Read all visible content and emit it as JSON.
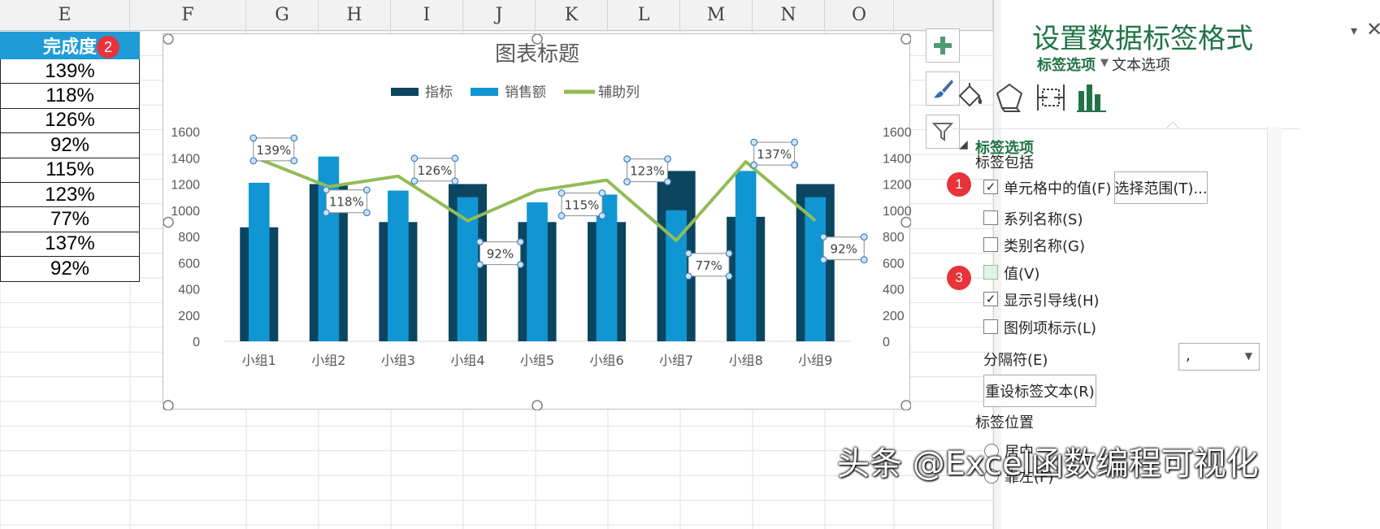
{
  "sheet": {
    "columns": [
      "E",
      "F",
      "G",
      "H",
      "I",
      "J",
      "K",
      "L",
      "M",
      "N",
      "O"
    ],
    "header_cell": "完成度",
    "header_badge": "2",
    "values": [
      "139%",
      "118%",
      "126%",
      "92%",
      "115%",
      "123%",
      "77%",
      "137%",
      "92%"
    ]
  },
  "chart": {
    "side_buttons": {
      "add": "plus-icon",
      "style": "brush-icon",
      "filter": "funnel-icon"
    }
  },
  "chart_data": {
    "type": "bar",
    "title": "图表标题",
    "categories": [
      "小组1",
      "小组2",
      "小组3",
      "小组4",
      "小组5",
      "小组6",
      "小组7",
      "小组8",
      "小组9"
    ],
    "series": [
      {
        "name": "指标",
        "type": "bar",
        "color": "#0b4560",
        "values": [
          870,
          1200,
          910,
          1200,
          910,
          910,
          1300,
          950,
          1200
        ]
      },
      {
        "name": "销售额",
        "type": "bar",
        "color": "#1096d2",
        "values": [
          1210,
          1410,
          1150,
          1100,
          1060,
          1120,
          1000,
          1300,
          1100
        ]
      },
      {
        "name": "辅助列",
        "type": "line",
        "color": "#93bb57",
        "values": [
          1390,
          1180,
          1260,
          920,
          1150,
          1230,
          770,
          1370,
          920
        ]
      }
    ],
    "data_labels": [
      "139%",
      "118%",
      "126%",
      "92%",
      "115%",
      "123%",
      "77%",
      "137%",
      "92%"
    ],
    "yticks": [
      "0",
      "200",
      "400",
      "600",
      "800",
      "1000",
      "1200",
      "1400",
      "1600"
    ],
    "ylim": [
      0,
      1600
    ],
    "secondary_axis": true,
    "legend_position": "top",
    "grid": false
  },
  "pane": {
    "title": "设置数据标签格式",
    "tabs": {
      "label_options": "标签选项",
      "text_options": "文本选项"
    },
    "section": "标签选项",
    "contains_label": "标签包括",
    "options": [
      {
        "label": "单元格中的值(F)",
        "checked": true
      },
      {
        "label": "系列名称(S)",
        "checked": false
      },
      {
        "label": "类别名称(G)",
        "checked": false
      },
      {
        "label": "值(V)",
        "checked": false
      },
      {
        "label": "显示引导线(H)",
        "checked": true
      },
      {
        "label": "图例项标示(L)",
        "checked": false
      }
    ],
    "select_range_button": "选择范围(T)...",
    "separator_label": "分隔符(E)",
    "separator_value": ",",
    "reset_button": "重设标签文本(R)",
    "position_label": "标签位置",
    "position_options": [
      "居中",
      "靠左(F)"
    ],
    "badges": [
      "1",
      "3"
    ]
  },
  "watermark": "头条 @Excel函数编程可视化"
}
